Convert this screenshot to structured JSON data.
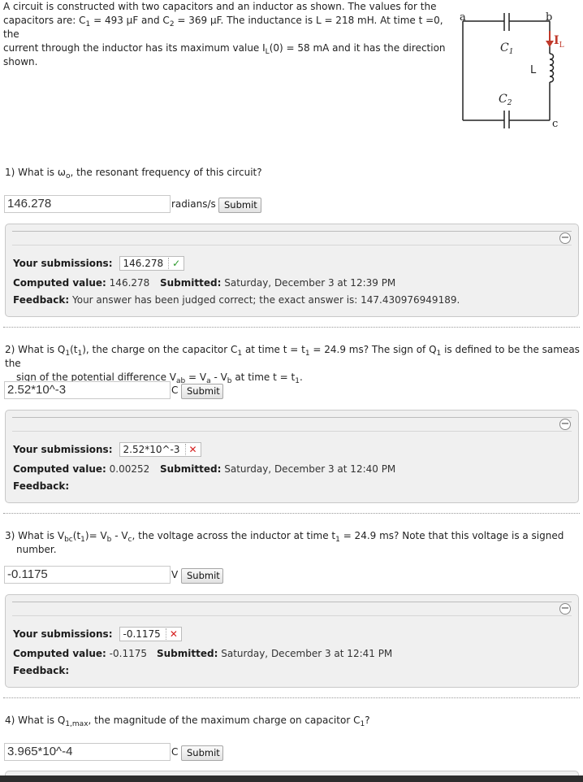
{
  "problem": {
    "intro_line1": "A circuit is constructed with two capacitors and an inductor as shown. The values for the",
    "intro_line2_a": "capacitors are: C",
    "intro_line2_sub1": "1",
    "intro_line2_b": " = 493 μF and C",
    "intro_line2_sub2": "2",
    "intro_line2_c": " = 369 μF. The inductance is L = 218 mH. At time t =0, the",
    "intro_line3_a": "current through the inductor has its maximum value I",
    "intro_line3_sub": "L",
    "intro_line3_b": "(0) = 58 mA and it has the direction",
    "intro_line4": "shown."
  },
  "circuit": {
    "label_a": "a",
    "label_b": "b",
    "label_c": "c",
    "label_c1": "C",
    "label_c1_sub": "1",
    "label_c2": "C",
    "label_c2_sub": "2",
    "label_L": "L",
    "label_I": "I",
    "label_I_sub": "L",
    "current_color": "#c0392b"
  },
  "questions": [
    {
      "text_a": "1) What is ω",
      "text_sub": "o",
      "text_b": ", the resonant frequency of this circuit?",
      "answer": "146.278",
      "unit": "radians/s",
      "submit": "Submit",
      "your_submissions_label": "Your submissions:",
      "submission_value": "146.278",
      "submission_status": "correct",
      "computed_label": "Computed value:",
      "computed_value": "146.278",
      "submitted_label": "Submitted:",
      "submitted_value": "Saturday, December 3 at 12:39 PM",
      "feedback_label": "Feedback:",
      "feedback_value": "Your answer has been judged correct; the exact answer is: 147.430976949189."
    },
    {
      "text_a": "2) What is Q",
      "text_sub1": "1",
      "text_b": "(t",
      "text_sub2": "1",
      "text_c": "), the charge on the capacitor C",
      "text_sub3": "1",
      "text_d": " at time t = t",
      "text_sub4": "1",
      "text_e": " = 24.9 ms? The sign of Q",
      "text_sub5": "1",
      "text_f": " is defined to be the sameas the",
      "line2_a": "sign of the potential difference V",
      "line2_sub1": "ab",
      "line2_b": " = V",
      "line2_sub2": "a",
      "line2_c": " - V",
      "line2_sub3": "b",
      "line2_d": " at time t = t",
      "line2_sub4": "1",
      "line2_e": ".",
      "answer": "2.52*10^-3",
      "unit": "C",
      "submit": "Submit",
      "your_submissions_label": "Your submissions:",
      "submission_value": "2.52*10^-3",
      "submission_status": "incorrect",
      "computed_label": "Computed value:",
      "computed_value": "0.00252",
      "submitted_label": "Submitted:",
      "submitted_value": "Saturday, December 3 at 12:40 PM",
      "feedback_label": "Feedback:"
    },
    {
      "text_a": "3) What is V",
      "text_sub1": "bc",
      "text_b": "(t",
      "text_sub2": "1",
      "text_c": ")= V",
      "text_sub3": "b",
      "text_d": " - V",
      "text_sub4": "c",
      "text_e": ", the voltage across the inductor at time t",
      "text_sub5": "1",
      "text_f": " = 24.9 ms? Note that this voltage is a signed",
      "line2": "number.",
      "answer": "-0.1175",
      "unit": "V",
      "submit": "Submit",
      "your_submissions_label": "Your submissions:",
      "submission_value": "-0.1175",
      "submission_status": "incorrect",
      "computed_label": "Computed value:",
      "computed_value": "-0.1175",
      "submitted_label": "Submitted:",
      "submitted_value": "Saturday, December 3 at 12:41 PM",
      "feedback_label": "Feedback:"
    },
    {
      "text_a": "4) What is Q",
      "text_sub1": "1,max",
      "text_b": ", the magnitude of the maximum charge on capacitor C",
      "text_sub2": "1",
      "text_c": "?",
      "answer": "3.965*10^-4",
      "unit": "C",
      "submit": "Submit"
    }
  ],
  "icons": {
    "collapse": "minus-circle-icon",
    "correct": "check-icon",
    "incorrect": "x-icon",
    "check_glyph": "✓",
    "x_glyph": "✕",
    "minus_glyph": "−"
  }
}
